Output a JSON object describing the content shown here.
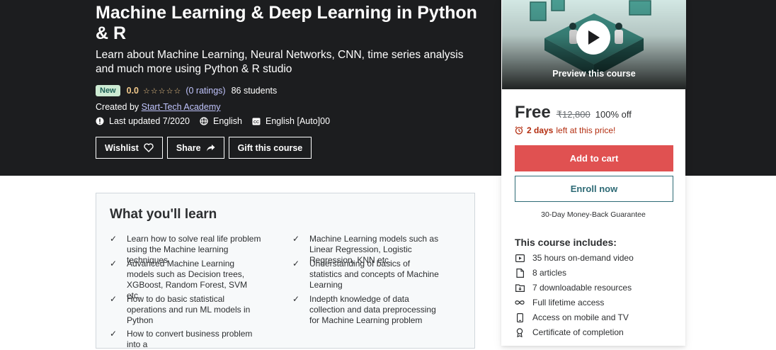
{
  "course": {
    "title": "Machine Learning & Deep Learning in Python & R",
    "subtitle": "Learn about Machine Learning, Neural Networks, CNN, time series analysis and much more using Python & R studio",
    "badge": "New",
    "rating": "0.0",
    "stars": "☆☆☆☆☆",
    "ratings_count": "(0 ratings)",
    "students": "86 students",
    "created_by_label": "Created by",
    "instructor": "Start-Tech Academy",
    "last_updated": "Last updated 7/2020",
    "language": "English",
    "captions": "English [Auto]00"
  },
  "actions": {
    "wishlist": "Wishlist",
    "share": "Share",
    "gift": "Gift this course"
  },
  "learn": {
    "title": "What you'll learn",
    "items": [
      "Learn how to solve real life problem using the Machine learning techniques",
      "Machine Learning models such as Linear Regression, Logistic Regression, KNN etc.",
      "Advanced Machine Learning models such as Decision trees, XGBoost, Random Forest, SVM etc.",
      "Understanding of basics of statistics and concepts of Machine Learning",
      "How to do basic statistical operations and run ML models in Python",
      "Indepth knowledge of data collection and data preprocessing for Machine Learning problem",
      "How to convert business problem into a"
    ]
  },
  "card": {
    "preview_label": "Preview this course",
    "price": "Free",
    "old_price": "₹12,800",
    "discount": "100% off",
    "timer_bold": "2 days",
    "timer_rest": "left at this price!",
    "add_to_cart": "Add to cart",
    "enroll": "Enroll now",
    "guarantee": "30-Day Money-Back Guarantee",
    "includes_title": "This course includes:",
    "includes": [
      {
        "icon": "video-icon",
        "text": "35 hours on-demand video"
      },
      {
        "icon": "file-icon",
        "text": "8 articles"
      },
      {
        "icon": "folder-download-icon",
        "text": "7 downloadable resources"
      },
      {
        "icon": "infinity-icon",
        "text": "Full lifetime access"
      },
      {
        "icon": "mobile-tv-icon",
        "text": "Access on mobile and TV"
      },
      {
        "icon": "certificate-icon",
        "text": "Certificate of completion"
      }
    ]
  },
  "colors": {
    "hero_bg": "#1c1d1f",
    "accent_red": "#e05151",
    "enroll_teal": "#2d6a75",
    "star": "#f3ca8c",
    "link": "#c0c4fc",
    "badge_bg": "#cdebd3",
    "timer_red": "#b32d0f"
  }
}
